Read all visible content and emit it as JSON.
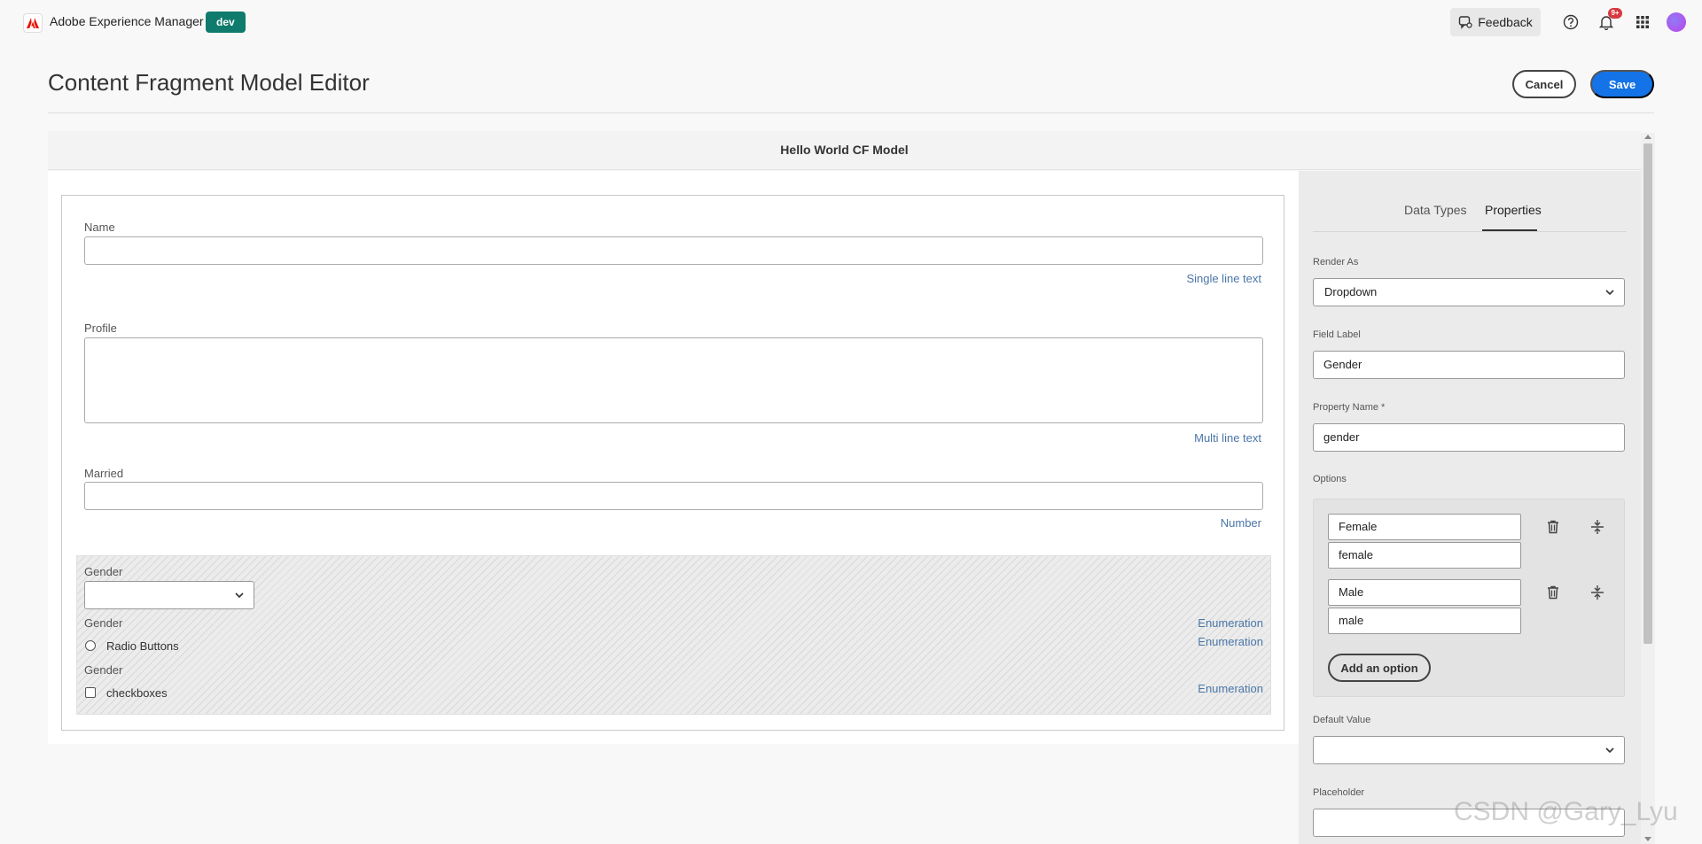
{
  "topbar": {
    "app_name": "Adobe Experience Manager",
    "env_badge": "dev",
    "feedback_label": "Feedback",
    "notifications_count": "9+"
  },
  "header": {
    "title": "Content Fragment Model Editor",
    "cancel_label": "Cancel",
    "save_label": "Save"
  },
  "model": {
    "title": "Hello World CF Model"
  },
  "canvas": {
    "fields": [
      {
        "label": "Name",
        "type": "Single line text"
      },
      {
        "label": "Profile",
        "type": "Multi line text"
      },
      {
        "label": "Married",
        "type": "Number"
      }
    ],
    "enum_fields": [
      {
        "label": "Gender",
        "type": "Enumeration"
      },
      {
        "label": "Gender",
        "type": "Enumeration",
        "option_text": "Radio Buttons"
      },
      {
        "label": "Gender",
        "type": "Enumeration",
        "option_text": "checkboxes"
      }
    ]
  },
  "panel": {
    "tabs": [
      "Data Types",
      "Properties"
    ],
    "active_tab": "Properties",
    "render_as_label": "Render As",
    "render_as_value": "Dropdown",
    "field_label_label": "Field Label",
    "field_label_value": "Gender",
    "property_name_label": "Property Name *",
    "property_name_value": "gender",
    "options_label": "Options",
    "options": [
      {
        "label": "Female",
        "value": "female"
      },
      {
        "label": "Male",
        "value": "male"
      }
    ],
    "add_option_label": "Add an option",
    "default_value_label": "Default Value",
    "default_value_value": "",
    "placeholder_label": "Placeholder",
    "placeholder_value": ""
  },
  "watermark": "CSDN @Gary_Lyu"
}
